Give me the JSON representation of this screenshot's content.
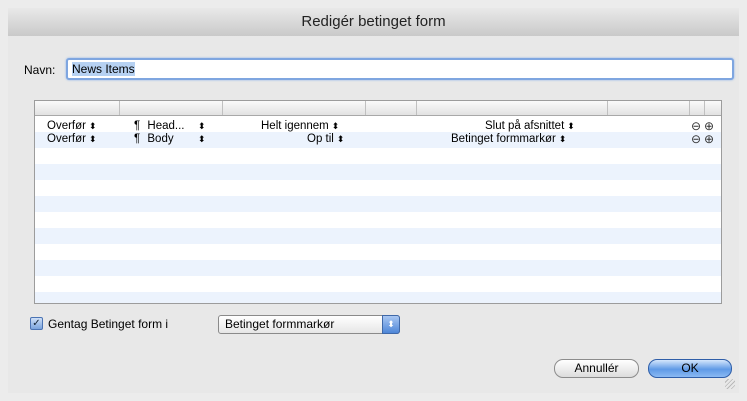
{
  "window": {
    "title": "Redigér betinget form"
  },
  "name_field": {
    "label": "Navn:",
    "value": "News Items"
  },
  "rules": [
    {
      "action": "Overfør",
      "style": "Head...",
      "scope": "Helt igennem",
      "end": "Slut på afsnittet"
    },
    {
      "action": "Overfør",
      "style": "Body",
      "scope": "Op til",
      "end": "Betinget formmarkør"
    }
  ],
  "icons": {
    "paragraph": "¶",
    "updown": "⬍",
    "remove": "⊖",
    "add": "⊕",
    "check": "✓"
  },
  "repeat": {
    "label": "Gentag Betinget form i",
    "checked": true,
    "selected": "Betinget formmarkør"
  },
  "buttons": {
    "cancel": "Annullér",
    "ok": "OK"
  }
}
